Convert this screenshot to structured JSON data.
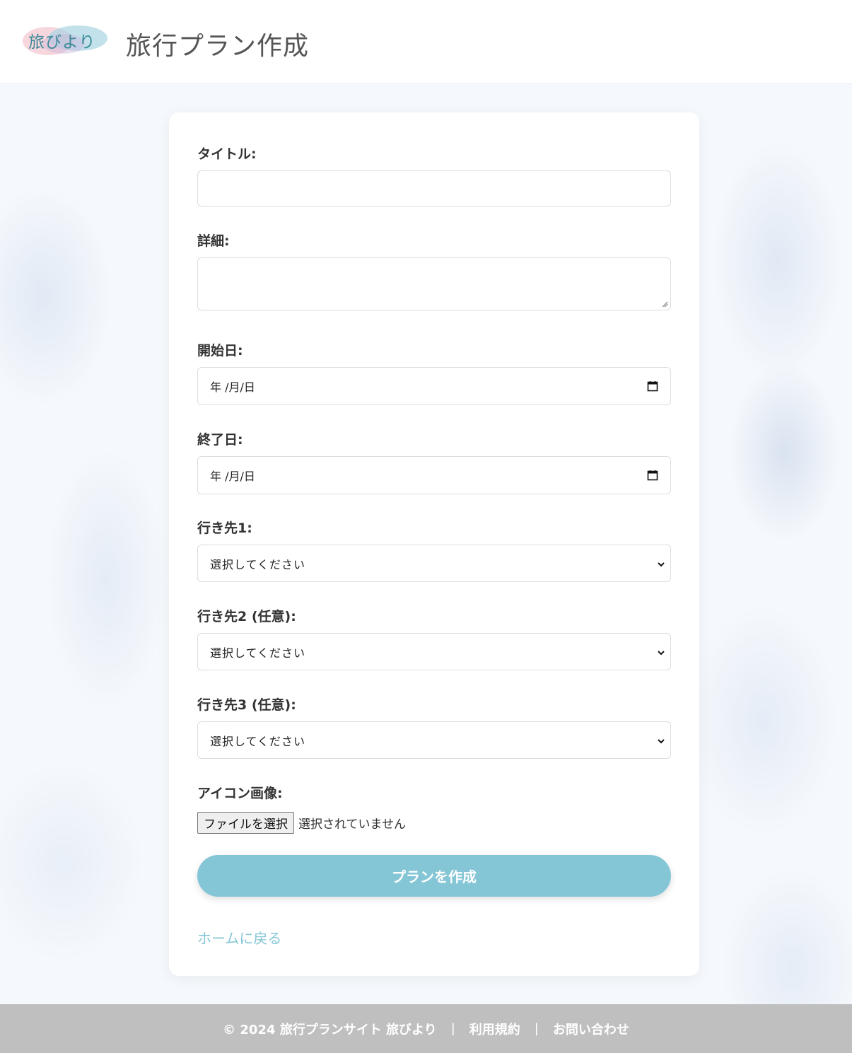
{
  "header": {
    "logo_text": "旅びより",
    "page_title": "旅行プラン作成"
  },
  "form": {
    "title_label": "タイトル:",
    "title_value": "",
    "detail_label": "詳細:",
    "detail_value": "",
    "start_date_label": "開始日:",
    "start_date_value": "年 /月/日",
    "end_date_label": "終了日:",
    "end_date_value": "年 /月/日",
    "dest1_label": "行き先1:",
    "dest1_value": "選択してください",
    "dest2_label": "行き先2 (任意):",
    "dest2_value": "選択してください",
    "dest3_label": "行き先3 (任意):",
    "dest3_value": "選択してください",
    "icon_label": "アイコン画像:",
    "file_button_label": "ファイルを選択",
    "file_status": "選択されていません",
    "submit_label": "プランを作成",
    "home_link": "ホームに戻る"
  },
  "footer": {
    "copyright": "© 2024 旅行プランサイト 旅びより",
    "separator": "|",
    "terms": "利用規約",
    "contact": "お問い合わせ"
  },
  "colors": {
    "accent": "#85c6d6",
    "logo": "#3c8a98",
    "footer_bg": "#bfbfbf"
  }
}
